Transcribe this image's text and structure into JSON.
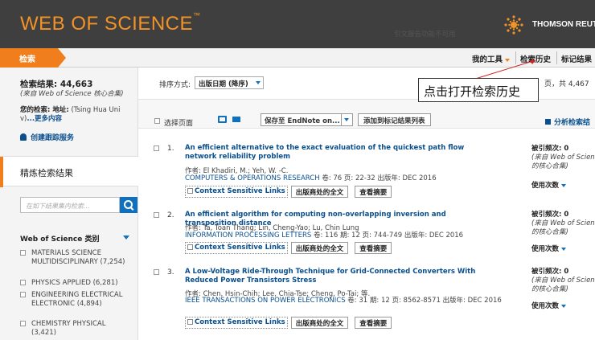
{
  "header": {
    "brand": "WEB OF SCIENCE",
    "brand_tm": "™",
    "publisher": "THOMSON REUTE"
  },
  "navbar": {
    "search_tab": "检索",
    "my_tools": "我的工具",
    "search_history": "检索历史",
    "marked_list": "标记结果"
  },
  "sidebar": {
    "results_label": "检索结果: 44,663",
    "results_db": "(来自 Web of Science 核心合集)",
    "your_search_label": "您的检索: 地址:",
    "your_search_value": "(Tsing Hua Uni v)",
    "more_link": "...更多内容",
    "create_alert": "创建跟踪服务",
    "refine_title": "精炼检索结果",
    "refine_placeholder": "在如下结果集内检索...",
    "category_title": "Web of Science 类别",
    "categories": [
      {
        "label": "MATERIALS SCIENCE MULTIDISCIPLINARY (7,254)"
      },
      {
        "label": "PHYSICS APPLIED (6,281)"
      },
      {
        "label": "ENGINEERING ELECTRICAL ELECTRONIC (4,894)"
      },
      {
        "label": "CHEMISTRY PHYSICAL (3,421)"
      }
    ]
  },
  "sortbar": {
    "sort_label": "排序方式:",
    "sort_value": "出版日期 (降序)",
    "pages": "页，共 4,467"
  },
  "toolbar": {
    "select_page": "选择页面",
    "save_to": "保存至 EndNote on...",
    "add_marked": "添加到标记结果列表",
    "analyze": "分析检索结",
    "citation_map": "引文报告功能不可用"
  },
  "records": [
    {
      "num": "1.",
      "title": "An efficient alternative to the exact evaluation of the quickest path flow network reliability problem",
      "authors": "作者: El Khadiri, M.; Yeh, W. -C.",
      "journal": "COMPUTERS & OPERATIONS RESEARCH",
      "source_rest": "  卷: 76  页: 22-32  出版年: DEC 2016",
      "ctx": "Context Sensitive Links",
      "pub_fulltext": "出版商处的全文",
      "view_abstract": "查看摘要",
      "cited_label": "被引频次: 0",
      "cited_db": "(来自 Web of Science 的核心合集)",
      "usage": "使用次数"
    },
    {
      "num": "2.",
      "title": "An efficient algorithm for computing non-overlapping inversion and transposition distance",
      "authors": "作者: Ta, Toan Thang; Lin, Cheng-Yao; Lu, Chin Lung",
      "journal": "INFORMATION PROCESSING LETTERS",
      "source_rest": "  卷: 116  期: 12  页: 744-749  出版年: DEC 2016",
      "ctx": "Context Sensitive Links",
      "pub_fulltext": "出版商处的全文",
      "view_abstract": "查看摘要",
      "cited_label": "被引频次: 0",
      "cited_db": "(来自 Web of Science 的核心合集)",
      "usage": "使用次数"
    },
    {
      "num": "3.",
      "title": "A Low-Voltage Ride-Through Technique for Grid-Connected Converters With Reduced Power Transistors Stress",
      "authors": "作者: Chen, Hsin-Chih; Lee, Chia-Tse; Cheng, Po-Tai; 等.",
      "journal": "IEEE TRANSACTIONS ON POWER ELECTRONICS",
      "source_rest": "  卷: 31  期: 12  页: 8562-8571  出版年: DEC 2016",
      "ctx": "Context Sensitive Links",
      "pub_fulltext": "出版商处的全文",
      "view_abstract": "查看摘要",
      "cited_label": "被引频次: 0",
      "cited_db": "(来自 Web of Science 的核心合集)",
      "usage": "使用次数"
    }
  ],
  "annotation": {
    "callout": "点击打开检索历史",
    "arrow_color": "#d42020"
  },
  "colors": {
    "brand_orange": "#f39326",
    "tab_orange": "#f07e1c",
    "link_blue": "#0a4f8e",
    "header_bg": "#3f3f3f"
  }
}
